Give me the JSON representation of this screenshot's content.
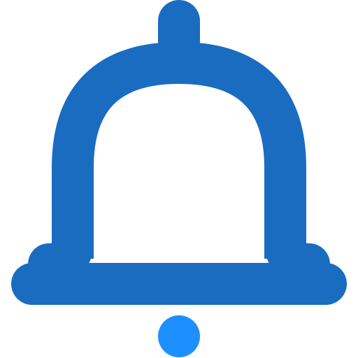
{
  "icon": {
    "name": "notification-bell-icon",
    "colors": {
      "bell": "#1A6CC1",
      "clapper_dot": "#1E8FFF",
      "background": "#FFFFFF"
    }
  }
}
